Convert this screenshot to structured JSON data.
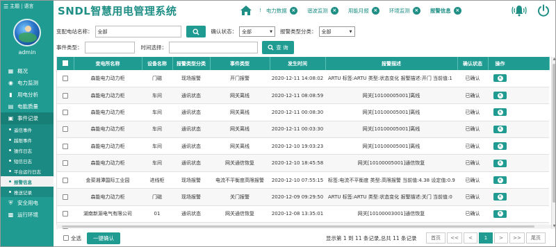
{
  "sidebar": {
    "top_home": "主题",
    "top_sep": "|",
    "top_lang": "语言",
    "username": "admin",
    "items": [
      {
        "label": "概况",
        "icon": "overview-icon"
      },
      {
        "label": "电力监测",
        "icon": "power-monitor-icon"
      },
      {
        "label": "用电分析",
        "icon": "bar-chart-icon"
      },
      {
        "label": "电能质量",
        "icon": "quality-icon"
      },
      {
        "label": "事件记录",
        "icon": "event-log-icon"
      }
    ],
    "sub_items": [
      {
        "label": "遥信事件"
      },
      {
        "label": "越限事件"
      },
      {
        "label": "操作日志"
      },
      {
        "label": "短信日志"
      },
      {
        "label": "平台运行日志"
      },
      {
        "label": "报警信息"
      },
      {
        "label": "推送记录"
      }
    ],
    "items_after": [
      {
        "label": "安全用电",
        "icon": "shield-icon"
      },
      {
        "label": "运行环境",
        "icon": "environment-icon"
      }
    ]
  },
  "header": {
    "title": "SNDL智慧用电管理系统",
    "tabs": [
      {
        "label": "电力数据"
      },
      {
        "label": "谐波监测"
      },
      {
        "label": "用能月报"
      },
      {
        "label": "环境监测"
      },
      {
        "label": "报警信息"
      }
    ]
  },
  "filters": {
    "station_label": "变配电站名称：",
    "station_value": "全部",
    "confirm_label": "确认状态：",
    "confirm_value": "全部",
    "alarm_type_label": "报警类型分类：",
    "alarm_type_value": "全部",
    "event_type_label": "事件类型：",
    "event_type_value": "",
    "time_label": "时间选择：",
    "time_value": "",
    "query_button": "查 询"
  },
  "table": {
    "columns": [
      "变电所名称",
      "设备名称",
      "报警类型分类",
      "事件类型",
      "发生时间",
      "报警描述",
      "确认状态",
      "操作"
    ],
    "rows": [
      [
        "森能电力动力柜",
        "门磁",
        "现场报警",
        "开门报警",
        "2020-12-11 14:08:02",
        "ARTU 标签:ARTU 类型:状态变化 报警描述:开门 当前值:1",
        "已确认"
      ],
      [
        "森能电力动力柜",
        "车间",
        "通讯状态",
        "网关离线",
        "2020-12-11 08:08:59",
        "网关[10100005001]离线",
        "已确认"
      ],
      [
        "森能电力动力柜",
        "车间",
        "通讯状态",
        "网关离线",
        "2020-12-11 00:08:30",
        "网关[10100005001]离线",
        "已确认"
      ],
      [
        "森能电力动力柜",
        "车间",
        "通讯状态",
        "网关离线",
        "2020-12-11 00:03:30",
        "网关[10100005001]离线",
        "已确认"
      ],
      [
        "森能电力动力柜",
        "车间",
        "通讯状态",
        "网关离线",
        "2020-12-10 19:03:23",
        "网关[10100005001]离线",
        "已确认"
      ],
      [
        "森能电力动力柜",
        "车间",
        "通讯状态",
        "网关通信恢复",
        "2020-12-10 18:45:58",
        "网关[10100005001]通信恢复",
        "已确认"
      ],
      [
        "金菜湘潭国际工业园",
        "进线柜",
        "现场报警",
        "电流不平衡度高限报警",
        "2020-12-10 07:55:15",
        "标签:电流不平衡度 类型:高限报警 当前值:4.38 设定值:0.9",
        "已确认"
      ],
      [
        "森能电力动力柜",
        "门磁",
        "现场报警",
        "关门报警",
        "2020-12-09 09:29:50",
        "ARTU 标签:ARTU 类型:状态变化 报警描述:关门 当前值:0",
        "已确认"
      ],
      [
        "湖南新源电气有限公司",
        "01",
        "通讯状态",
        "网关通信恢复",
        "2020-12-08 13:35:01",
        "网关[10100003001]通信恢复",
        "已确认"
      ],
      [
        "",
        "",
        "",
        "",
        "",
        "",
        ""
      ]
    ]
  },
  "footer": {
    "select_all": "全选",
    "confirm_button": "一键确认",
    "page_info": "显示第 1 到 11 条记录,总共 11 条记录",
    "pager": [
      "首页",
      "<<",
      "<",
      "1",
      ">",
      ">>",
      "尾页"
    ]
  },
  "colors": {
    "primary": "#1f9b91",
    "sidebar_dark": "#187f77"
  }
}
